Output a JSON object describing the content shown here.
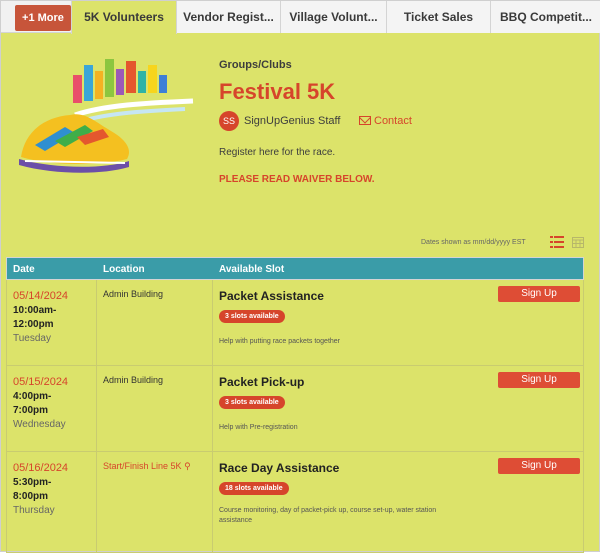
{
  "tabs": {
    "more": "+1 More",
    "items": [
      "5K Volunteers",
      "Vendor Regist...",
      "Village Volunt...",
      "Ticket Sales",
      "BBQ Competit..."
    ],
    "active_index": 0
  },
  "header": {
    "category": "Groups/Clubs",
    "title": "Festival 5K",
    "owner_initials": "SS",
    "owner_name": "SignUpGenius Staff",
    "contact_label": "Contact",
    "description": "Register here for the race.",
    "waiver_note": "PLEASE READ WAIVER BELOW."
  },
  "dates_note": "Dates shown as mm/dd/yyyy EST",
  "table": {
    "headers": {
      "date": "Date",
      "location": "Location",
      "slot": "Available Slot"
    },
    "rows": [
      {
        "date": "05/14/2024",
        "time_start": "10:00am-",
        "time_end": "12:00pm",
        "weekday": "Tuesday",
        "location": "Admin Building",
        "slot_title": "Packet Assistance",
        "slots_available": "3 slots available",
        "description": "Help with putting race packets together",
        "signup_label": "Sign Up"
      },
      {
        "date": "05/15/2024",
        "time_start": "4:00pm-",
        "time_end": "7:00pm",
        "weekday": "Wednesday",
        "location": "Admin Building",
        "slot_title": "Packet Pick-up",
        "slots_available": "3 slots available",
        "description": "Help with Pre-registration",
        "signup_label": "Sign Up"
      },
      {
        "date": "05/16/2024",
        "time_start": "5:30pm-",
        "time_end": "8:00pm",
        "weekday": "Thursday",
        "location": "Start/Finish Line 5K",
        "slot_title": "Race Day Assistance",
        "slots_available": "18 slots available",
        "description": "Course monitoring, day of packet-pick up, course set-up, water station assistance",
        "signup_label": "Sign Up"
      }
    ]
  },
  "colors": {
    "accent": "#d6452b",
    "header_bg": "#3a9ca8",
    "page_bg": "#dce36a"
  }
}
